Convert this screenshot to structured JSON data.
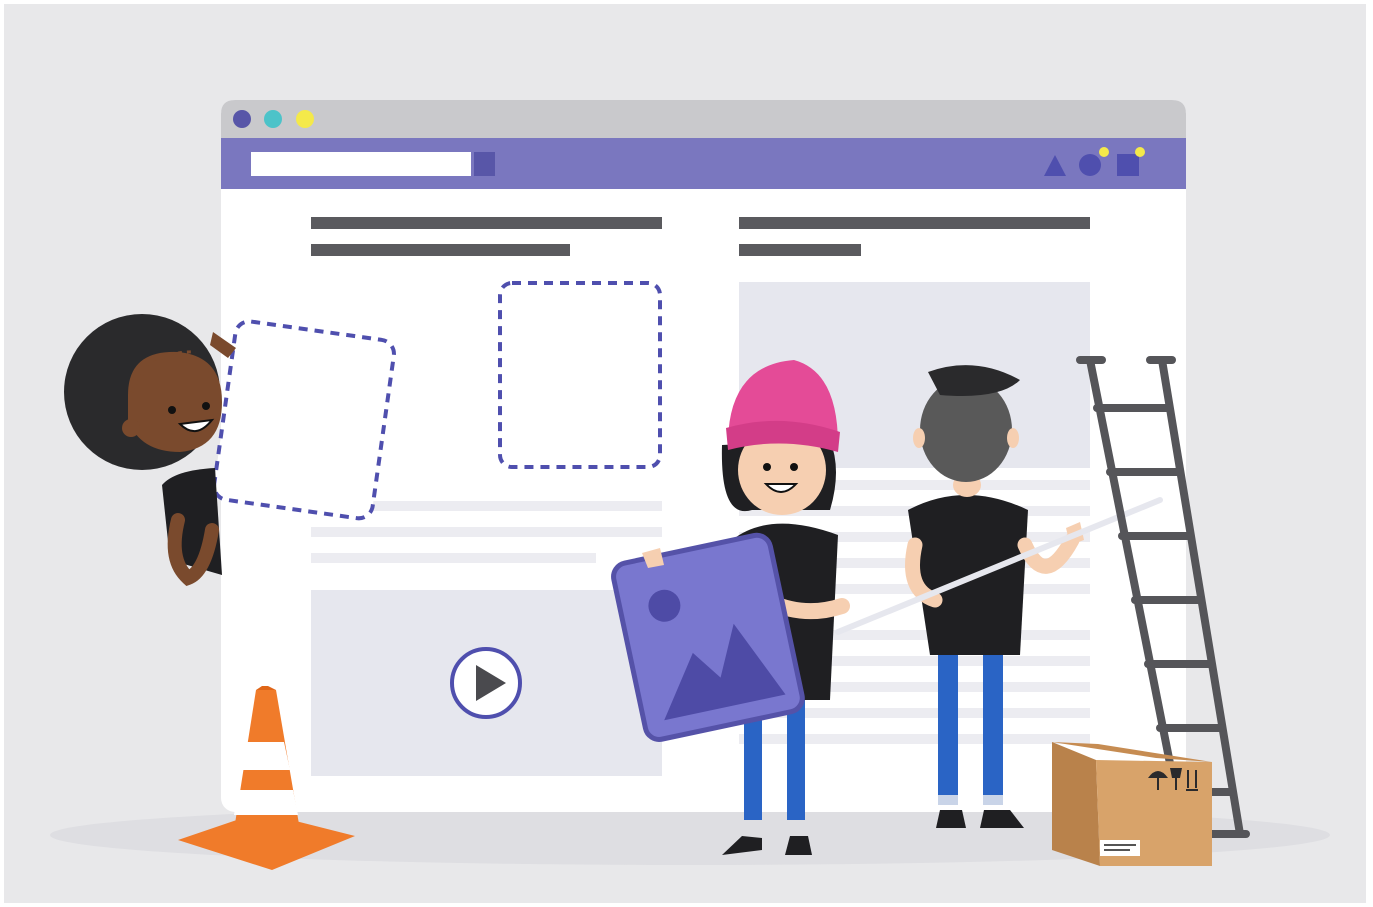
{
  "colors": {
    "background": "#e8e8ea",
    "browser_chrome": "#c9c9cc",
    "toolbar": "#7a77bf",
    "page": "#ffffff",
    "text_bar": "#5a5a5e",
    "placeholder": "#e6e7ee",
    "dashed_outline": "#4f4fae",
    "dot_purple": "#5856a8",
    "dot_teal": "#4cc3c9",
    "dot_yellow": "#f4e94a",
    "beanie_pink": "#e44b97",
    "cone_orange": "#f07b2a",
    "box_brown": "#d8a36a",
    "ladder_gray": "#555559",
    "shirt_black": "#1f1f22",
    "jeans_blue": "#2a64c5",
    "skin_light": "#f6cfb1",
    "skin_dark": "#7a4a2d",
    "hair_dark": "#2a2a2c",
    "hair_gray": "#595959",
    "picture_frame": "#6f6cc3",
    "picture_fill": "#7977cf",
    "mountain": "#4e4ba6"
  },
  "browser": {
    "traffic_lights": [
      "dot-purple",
      "dot-teal",
      "dot-yellow"
    ],
    "toolbar_icons": [
      "triangle-icon",
      "circle-icon",
      "square-icon"
    ]
  },
  "illustration_items": {
    "cone": "traffic-cone-icon",
    "box": "cardboard-box-icon",
    "box_symbols": [
      "umbrella-icon",
      "this-way-up-icon",
      "fragile-icon"
    ],
    "ladder": "ladder-icon",
    "play": "play-icon",
    "image_frame": "image-icon"
  }
}
